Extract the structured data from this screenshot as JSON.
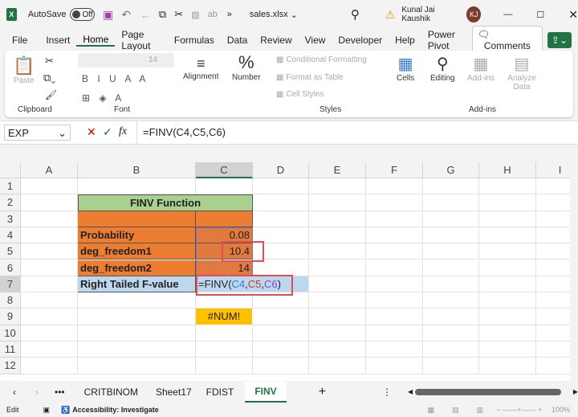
{
  "titlebar": {
    "autosave": "AutoSave",
    "toggle": "Off",
    "filename": "sales.xlsx",
    "user": "Kunal Jai Kaushik",
    "initials": "KJ"
  },
  "menu": [
    "File",
    "Insert",
    "Home",
    "Page Layout",
    "Formulas",
    "Data",
    "Review",
    "View",
    "Developer",
    "Help",
    "Power Pivot"
  ],
  "comments": "Comments",
  "ribbon": {
    "paste": "Paste",
    "clipboard": "Clipboard",
    "font_size": "14",
    "font": "Font",
    "alignment": "Alignment",
    "number": "Number",
    "cond_fmt": "Conditional Formatting",
    "fmt_table": "Format as Table",
    "cell_styles": "Cell Styles",
    "styles": "Styles",
    "cells": "Cells",
    "editing": "Editing",
    "addins": "Add-ins",
    "addins_group": "Add-ins",
    "analyze": "Analyze Data"
  },
  "formula_bar": {
    "name_box": "EXP",
    "fx": "fx",
    "formula": "=FINV(C4,C5,C6)"
  },
  "columns": [
    "A",
    "B",
    "C",
    "D",
    "E",
    "F",
    "G",
    "H",
    "I"
  ],
  "rows": [
    "1",
    "2",
    "3",
    "4",
    "5",
    "6",
    "7",
    "8",
    "9",
    "10",
    "11",
    "12"
  ],
  "cells": {
    "title": "FINV Function",
    "b4": "Probability",
    "c4": "0.08",
    "b5": "deg_freedom1",
    "c5": "10.4",
    "b6": "deg_freedom2",
    "c6": "14",
    "b7": "Right Tailed F-value",
    "c7_eq": "=FINV(",
    "c7_a": "C4",
    ",1": ",",
    "c7_b": "C5",
    ",2": ",",
    "c7_c": "C6",
    "c7_close": ")",
    "c9": "#NUM!"
  },
  "sheets": [
    "CRITBINOM",
    "Sheet17",
    "FDIST",
    "FINV"
  ],
  "status": {
    "mode": "Edit",
    "accessibility": "Accessibility: Investigate",
    "zoom": "100%"
  },
  "colors": {
    "green": "#a9d08e",
    "orange": "#ed7d31",
    "blue": "#bdd7ee",
    "yellow": "#ffc000",
    "accent": "#217346"
  }
}
